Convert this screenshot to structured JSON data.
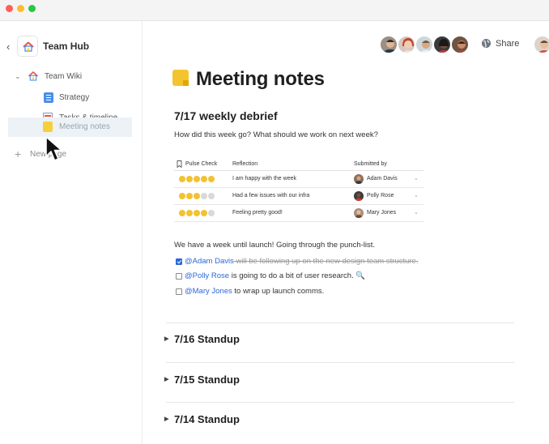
{
  "sidebar": {
    "hub_title": "Team Hub",
    "tree": {
      "root_label": "Team Wiki",
      "items": [
        {
          "label": "Strategy",
          "icon": "doc-icon"
        },
        {
          "label": "Tasks & timeline",
          "icon": "sheet-icon"
        },
        {
          "label": "Meeting notes",
          "icon": "note-icon",
          "selected": true
        }
      ]
    },
    "new_page_label": "New page"
  },
  "topbar": {
    "share_label": "Share"
  },
  "page": {
    "title": "Meeting notes",
    "sections": [
      {
        "heading": "7/17 weekly debrief",
        "prompt": "How did this week go? What should we work on next week?",
        "table": {
          "columns": [
            "Pulse Check",
            "Reflection",
            "Submitted by"
          ],
          "rows": [
            {
              "pulse": 5,
              "reflection": "I am happy with the week",
              "submitted_by": "Adam Davis"
            },
            {
              "pulse": 3,
              "reflection": "Had a few issues with our infra",
              "submitted_by": "Polly Rose"
            },
            {
              "pulse": 4,
              "reflection": "Feeling pretty good!",
              "submitted_by": "Mary Jones"
            }
          ],
          "pulse_max": 5
        },
        "punch_intro": "We have a week until launch! Going through the punch-list.",
        "checklist": [
          {
            "mention": "@Adam Davis",
            "text": " will be following up on the new design team structure.",
            "checked": true
          },
          {
            "mention": "@Polly Rose",
            "text": " is going to do a bit of user research. 🔍",
            "checked": false
          },
          {
            "mention": "@Mary Jones",
            "text": "  to wrap up launch comms.",
            "checked": false
          }
        ]
      }
    ],
    "collapsed_sections": [
      "7/16 Standup",
      "7/15 Standup",
      "7/14 Standup"
    ]
  },
  "colors": {
    "accent": "#2b68d9",
    "smile_on": "#f2c230",
    "smile_off": "#d9d9d9",
    "selected_row": "#edf2f7"
  }
}
